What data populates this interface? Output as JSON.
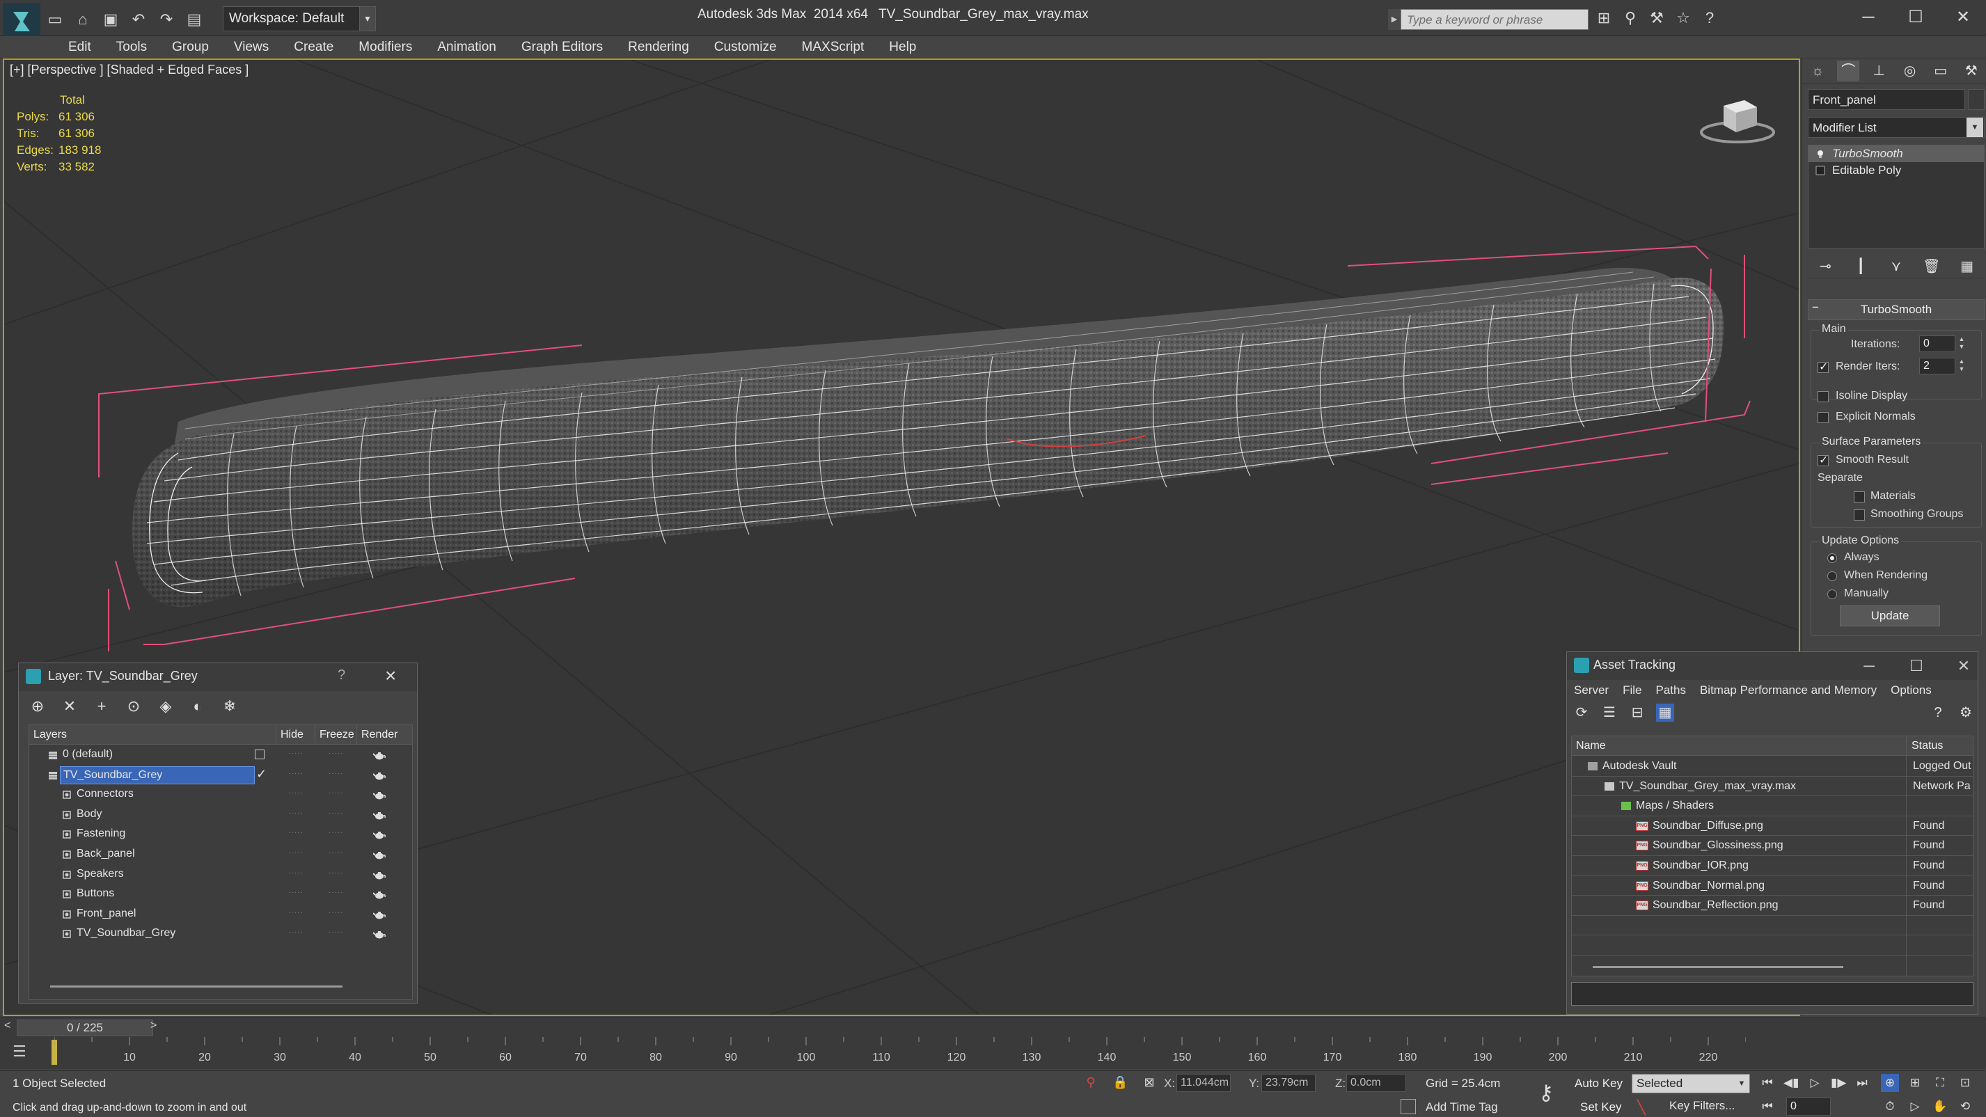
{
  "colors": {
    "viewport_border": "#b59d28",
    "stats_text": "#e8d94a",
    "selection": "#3a66b8",
    "wire_white": "#f0f0f0",
    "bbox_pink": "#e0507a"
  },
  "titlebar": {
    "workspace": "Workspace: Default",
    "app_title": "Autodesk 3ds Max  2014 x64",
    "file_title": "TV_Soundbar_Grey_max_vray.max",
    "search_placeholder": "Type a keyword or phrase",
    "quick_access_icons": [
      "new-file-icon",
      "open-file-icon",
      "save-icon",
      "undo-icon",
      "redo-icon",
      "project-folder-icon"
    ],
    "tool_icons": [
      "binoculars-icon",
      "subscription-icon",
      "communication-center-icon",
      "favorites-star-icon",
      "help-icon"
    ]
  },
  "menu": [
    "Edit",
    "Tools",
    "Group",
    "Views",
    "Create",
    "Modifiers",
    "Animation",
    "Graph Editors",
    "Rendering",
    "Customize",
    "MAXScript",
    "Help"
  ],
  "viewport": {
    "label": "[+] [Perspective ] [Shaded + Edged Faces ]",
    "stats": {
      "header": "Total",
      "rows": [
        {
          "key": "Polys:",
          "value": "61 306"
        },
        {
          "key": "Tris:",
          "value": "61 306"
        },
        {
          "key": "Edges:",
          "value": "183 918"
        },
        {
          "key": "Verts:",
          "value": "33 582"
        }
      ]
    }
  },
  "command_panel": {
    "tab_icons": [
      "create-icon",
      "modify-icon",
      "hierarchy-icon",
      "motion-icon",
      "display-icon",
      "utilities-icon"
    ],
    "object_name": "Front_panel",
    "modifier_list": "Modifier List",
    "stack": [
      "TurboSmooth",
      "Editable Poly"
    ],
    "stack_tool_icons": [
      "pin-stack-icon",
      "show-end-result-icon",
      "make-unique-icon",
      "remove-modifier-icon",
      "configure-sets-icon"
    ],
    "rollout_title": "TurboSmooth",
    "main_label": "Main",
    "iterations_label": "Iterations:",
    "iterations_value": "0",
    "render_iters_label": "Render Iters:",
    "render_iters_value": "2",
    "isoline_label": "Isoline Display",
    "explicit_normals_label": "Explicit Normals",
    "surface_label": "Surface Parameters",
    "smooth_result_label": "Smooth Result",
    "separate_label": "Separate",
    "materials_label": "Materials",
    "smoothing_groups_label": "Smoothing Groups",
    "update_options_label": "Update Options",
    "always_label": "Always",
    "when_rendering_label": "When Rendering",
    "manually_label": "Manually",
    "update_button": "Update"
  },
  "layer_dialog": {
    "title": "Layer: TV_Soundbar_Grey",
    "help": "?",
    "toolbar_icons": [
      "create-layer-icon",
      "delete-layer-icon",
      "add-to-layer-icon",
      "select-in-layer-icon",
      "highlight-selected-icon",
      "hide-all-icon",
      "freeze-all-icon"
    ],
    "columns": [
      "Layers",
      "Hide",
      "Freeze",
      "Render"
    ],
    "rows": [
      {
        "name": "0 (default)",
        "kind": "layer",
        "indent": 0,
        "selected": false
      },
      {
        "name": "TV_Soundbar_Grey",
        "kind": "layer",
        "indent": 0,
        "selected": true
      },
      {
        "name": "Connectors",
        "kind": "object",
        "indent": 1,
        "selected": false
      },
      {
        "name": "Body",
        "kind": "object",
        "indent": 1,
        "selected": false
      },
      {
        "name": "Fastening",
        "kind": "object",
        "indent": 1,
        "selected": false
      },
      {
        "name": "Back_panel",
        "kind": "object",
        "indent": 1,
        "selected": false
      },
      {
        "name": "Speakers",
        "kind": "object",
        "indent": 1,
        "selected": false
      },
      {
        "name": "Buttons",
        "kind": "object",
        "indent": 1,
        "selected": false
      },
      {
        "name": "Front_panel",
        "kind": "object",
        "indent": 1,
        "selected": false
      },
      {
        "name": "TV_Soundbar_Grey",
        "kind": "object",
        "indent": 1,
        "selected": false
      }
    ],
    "dots": "·····"
  },
  "asset_tracking": {
    "title": "Asset Tracking",
    "menu": [
      "Server",
      "File",
      "Paths",
      "Bitmap Performance and Memory",
      "Options"
    ],
    "toolbar_icons": [
      "refresh-icon",
      "list-view-icon",
      "tree-view-icon",
      "table-view-icon"
    ],
    "right_icons": [
      "help-icon",
      "settings-icon"
    ],
    "columns": [
      "Name",
      "Status"
    ],
    "rows": [
      {
        "name": "Autodesk Vault",
        "status": "Logged Out",
        "indent": 1,
        "icon": "vault-icon"
      },
      {
        "name": "TV_Soundbar_Grey_max_vray.max",
        "status": "Network Pa",
        "indent": 2,
        "icon": "max-file-icon"
      },
      {
        "name": "Maps / Shaders",
        "status": "",
        "indent": 3,
        "icon": "maps-folder-icon"
      },
      {
        "name": "Soundbar_Diffuse.png",
        "status": "Found",
        "indent": 4,
        "icon": "png-file-icon"
      },
      {
        "name": "Soundbar_Glossiness.png",
        "status": "Found",
        "indent": 4,
        "icon": "png-file-icon"
      },
      {
        "name": "Soundbar_IOR.png",
        "status": "Found",
        "indent": 4,
        "icon": "png-file-icon"
      },
      {
        "name": "Soundbar_Normal.png",
        "status": "Found",
        "indent": 4,
        "icon": "png-file-icon"
      },
      {
        "name": "Soundbar_Reflection.png",
        "status": "Found",
        "indent": 4,
        "icon": "png-file-icon"
      }
    ],
    "png_label": "PNG"
  },
  "timeline": {
    "frame_display": "0 / 225",
    "ticks": [
      "10",
      "20",
      "30",
      "40",
      "50",
      "60",
      "70",
      "80",
      "90",
      "100",
      "110",
      "120",
      "130",
      "140",
      "150",
      "160",
      "170",
      "180",
      "190",
      "200",
      "210",
      "220"
    ],
    "frame_max": 225
  },
  "statusbar": {
    "selection_count": "1 Object Selected",
    "prompt": "Click and drag up-and-down to zoom in and out",
    "x_label": "X:",
    "x_value": "11.044cm",
    "y_label": "Y:",
    "y_value": "23.79cm",
    "z_label": "Z:",
    "z_value": "0.0cm",
    "grid": "Grid = 25.4cm",
    "add_time_tag": "Add Time Tag",
    "auto_key": "Auto Key",
    "set_key": "Set Key",
    "selected_option": "Selected",
    "key_filters": "Key Filters...",
    "current_frame": "0"
  }
}
